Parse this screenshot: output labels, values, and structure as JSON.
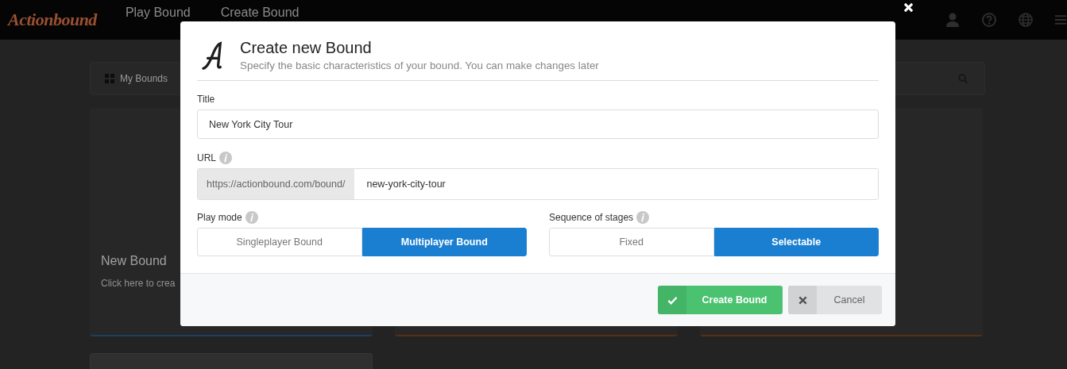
{
  "topbar": {
    "logo": "Actionbound",
    "nav": [
      {
        "label": "Play Bound"
      },
      {
        "label": "Create Bound"
      }
    ]
  },
  "toolbar": {
    "tab": "My Bounds"
  },
  "cards": [
    {
      "title": "New Bound",
      "text": "Click here to crea",
      "color": "#1d3f66"
    },
    {
      "color": "#5a2e12"
    },
    {
      "color": "#5a2e12"
    }
  ],
  "dialog": {
    "title": "Create new Bound",
    "subtitle": "Specify the basic characteristics of your bound. You can make changes later",
    "title_field": {
      "label": "Title",
      "value": "New York City Tour"
    },
    "url_field": {
      "label": "URL",
      "prefix": "https://actionbound.com/bound/",
      "value": "new-york-city-tour"
    },
    "groups": [
      {
        "label": "Play mode",
        "options": [
          {
            "label": "Singleplayer Bound",
            "selected": false
          },
          {
            "label": "Multiplayer Bound",
            "selected": true
          }
        ]
      },
      {
        "label": "Sequence of stages",
        "options": [
          {
            "label": "Fixed",
            "selected": false
          },
          {
            "label": "Selectable",
            "selected": true
          }
        ]
      }
    ],
    "buttons": [
      {
        "kind": "primary",
        "label": "Create Bound"
      },
      {
        "kind": "secondary",
        "label": "Cancel"
      }
    ]
  }
}
